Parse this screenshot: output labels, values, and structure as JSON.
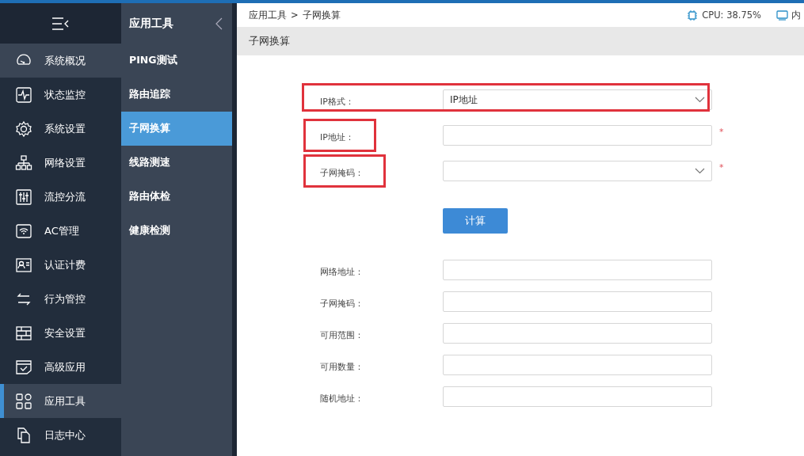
{
  "nav": {
    "items": [
      {
        "label": "系统概况",
        "selected": false,
        "hovered": true
      },
      {
        "label": "状态监控",
        "selected": false,
        "hovered": false
      },
      {
        "label": "系统设置",
        "selected": false,
        "hovered": false
      },
      {
        "label": "网络设置",
        "selected": false,
        "hovered": false
      },
      {
        "label": "流控分流",
        "selected": false,
        "hovered": false
      },
      {
        "label": "AC管理",
        "selected": false,
        "hovered": false
      },
      {
        "label": "认证计费",
        "selected": false,
        "hovered": false
      },
      {
        "label": "行为管控",
        "selected": false,
        "hovered": false
      },
      {
        "label": "安全设置",
        "selected": false,
        "hovered": false
      },
      {
        "label": "高级应用",
        "selected": false,
        "hovered": false
      },
      {
        "label": "应用工具",
        "selected": true,
        "hovered": false
      },
      {
        "label": "日志中心",
        "selected": false,
        "hovered": false
      }
    ]
  },
  "subnav": {
    "title": "应用工具",
    "items": [
      {
        "label": "PING测试",
        "selected": false
      },
      {
        "label": "路由追踪",
        "selected": false
      },
      {
        "label": "子网换算",
        "selected": true
      },
      {
        "label": "线路测速",
        "selected": false
      },
      {
        "label": "路由体检",
        "selected": false
      },
      {
        "label": "健康检测",
        "selected": false
      }
    ]
  },
  "breadcrumb": [
    "应用工具",
    "子网换算"
  ],
  "breadcrumb_separator": ">",
  "stats": [
    {
      "label": "CPU: 38.75%"
    },
    {
      "label": "内"
    }
  ],
  "page_title": "子网换算",
  "form": {
    "fields": [
      {
        "kind": "select",
        "label": "IP格式：",
        "value": "IP地址",
        "required": false,
        "highlight_row": true,
        "highlight_label": false
      },
      {
        "kind": "text",
        "label": "IP地址：",
        "required": true,
        "highlight_row": false,
        "highlight_label": true
      },
      {
        "kind": "select",
        "label": "子网掩码：",
        "required": true,
        "highlight_row": false,
        "highlight_label": true
      }
    ],
    "required_mark": "*",
    "button": "计算",
    "results": [
      {
        "label": "网络地址："
      },
      {
        "label": "子网掩码："
      },
      {
        "label": "可用范围："
      },
      {
        "label": "可用数量："
      },
      {
        "label": "随机地址："
      }
    ]
  }
}
